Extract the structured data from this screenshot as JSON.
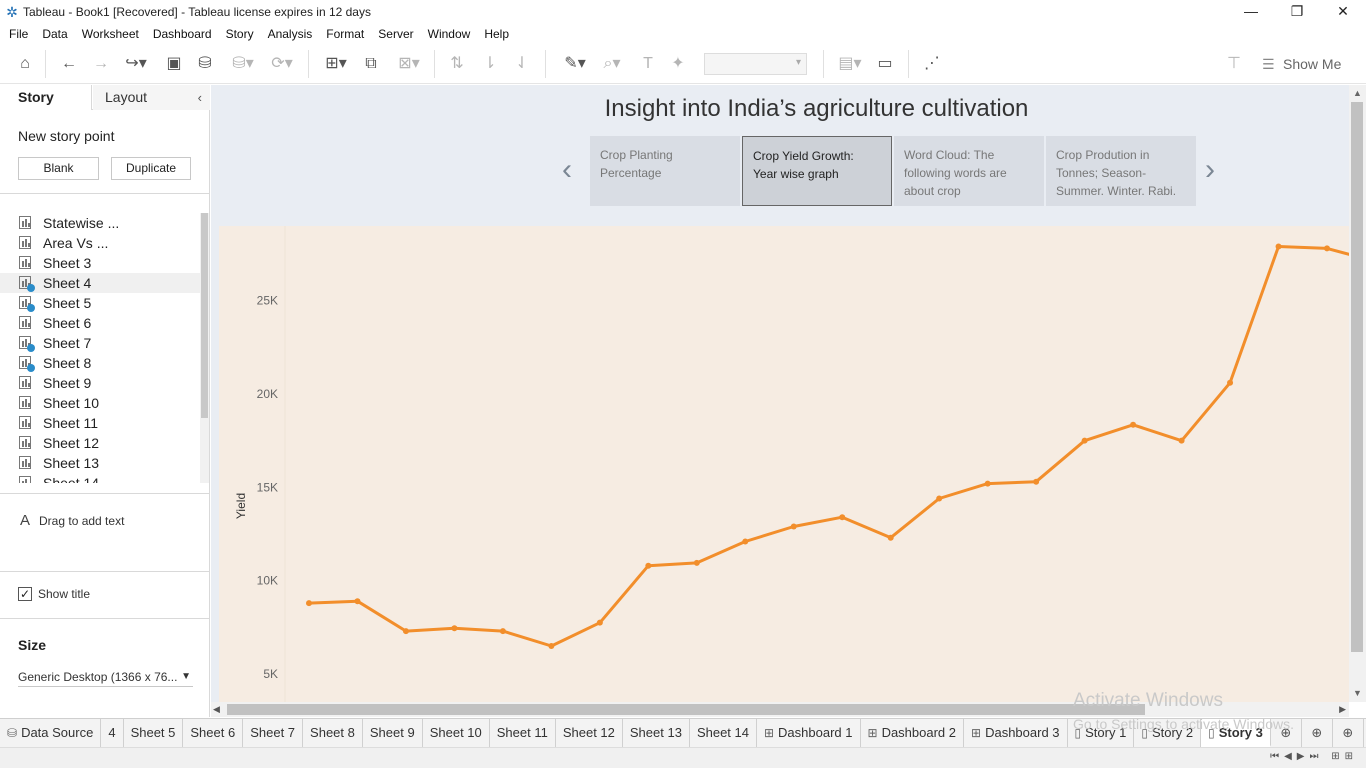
{
  "window": {
    "title": "Tableau - Book1 [Recovered] - Tableau license expires in 12 days",
    "controls": [
      "—",
      "❐",
      "✕"
    ]
  },
  "menu": [
    "File",
    "Data",
    "Worksheet",
    "Dashboard",
    "Story",
    "Analysis",
    "Format",
    "Server",
    "Window",
    "Help"
  ],
  "toolbar": {
    "show_me": "Show Me"
  },
  "left_pane": {
    "tab_story": "Story",
    "tab_layout": "Layout",
    "new_story_point": "New story point",
    "blank_button": "Blank",
    "duplicate_button": "Duplicate",
    "sheets": [
      {
        "label": "Statewise ...",
        "used": false
      },
      {
        "label": "Area Vs ...",
        "used": false
      },
      {
        "label": "Sheet 3",
        "used": false
      },
      {
        "label": "Sheet 4",
        "used": true
      },
      {
        "label": "Sheet 5",
        "used": true
      },
      {
        "label": "Sheet 6",
        "used": false
      },
      {
        "label": "Sheet 7",
        "used": true
      },
      {
        "label": "Sheet 8",
        "used": true
      },
      {
        "label": "Sheet 9",
        "used": false
      },
      {
        "label": "Sheet 10",
        "used": false
      },
      {
        "label": "Sheet 11",
        "used": false
      },
      {
        "label": "Sheet 12",
        "used": false
      },
      {
        "label": "Sheet 13",
        "used": false
      },
      {
        "label": "Sheet 14",
        "used": false
      }
    ],
    "drag_text_icon": "A",
    "drag_text": "Drag to add text",
    "show_title": "Show title",
    "size_label": "Size",
    "size_value": "Generic Desktop (1366 x 76..."
  },
  "story": {
    "title": "Insight into India’s agriculture cultivation",
    "points": [
      "Crop Planting Percentage",
      "Crop Yield Growth: Year wise graph",
      "Word Cloud: The following words are about crop",
      "Crop Prodution in Tonnes; Season- Summer. Winter. Rabi."
    ],
    "active_point": 1
  },
  "chart_data": {
    "type": "line",
    "ylabel": "Yield",
    "yticks": [
      5000,
      10000,
      15000,
      20000,
      25000
    ],
    "ytick_labels": [
      "5K",
      "10K",
      "15K",
      "20K",
      "25K"
    ],
    "ylim": [
      3500,
      29000
    ],
    "color": "#f28e2b",
    "values": [
      8800,
      8900,
      7300,
      7450,
      7300,
      6500,
      7750,
      10800,
      10950,
      12100,
      12900,
      13400,
      12300,
      14400,
      15200,
      15300,
      17500,
      18350,
      17500,
      20600,
      27900,
      27800,
      27100
    ]
  },
  "bottom_tabs": [
    {
      "label": "Data Source",
      "icon": "⛁"
    },
    {
      "label": "4",
      "icon": ""
    },
    {
      "label": "Sheet 5",
      "icon": ""
    },
    {
      "label": "Sheet 6",
      "icon": ""
    },
    {
      "label": "Sheet 7",
      "icon": ""
    },
    {
      "label": "Sheet 8",
      "icon": ""
    },
    {
      "label": "Sheet 9",
      "icon": ""
    },
    {
      "label": "Sheet 10",
      "icon": ""
    },
    {
      "label": "Sheet 11",
      "icon": ""
    },
    {
      "label": "Sheet 12",
      "icon": ""
    },
    {
      "label": "Sheet 13",
      "icon": ""
    },
    {
      "label": "Sheet 14",
      "icon": ""
    },
    {
      "label": "Dashboard 1",
      "icon": "⊞"
    },
    {
      "label": "Dashboard 2",
      "icon": "⊞"
    },
    {
      "label": "Dashboard 3",
      "icon": "⊞"
    },
    {
      "label": "Story 1",
      "icon": "▯"
    },
    {
      "label": "Story 2",
      "icon": "▯"
    },
    {
      "label": "Story 3",
      "icon": "▯"
    }
  ],
  "active_tab": "Story 3",
  "watermark": {
    "line1": "Activate Windows",
    "line2": "Go to Settings to activate Windows."
  }
}
